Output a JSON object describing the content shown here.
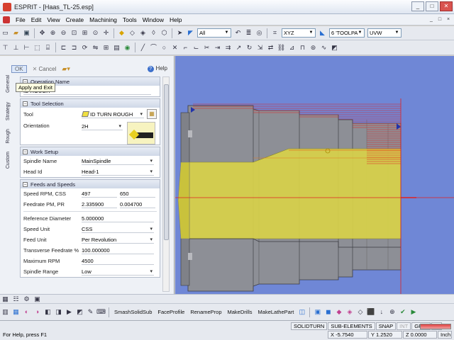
{
  "window": {
    "title": "ESPRIT - [Haas_TL-25.esp]",
    "buttons": [
      "_",
      "□",
      "✕"
    ]
  },
  "menu": {
    "items": [
      "File",
      "Edit",
      "View",
      "Create",
      "Machining",
      "Tools",
      "Window",
      "Help"
    ],
    "mdi_buttons": [
      "_",
      "□",
      "×"
    ]
  },
  "toolbar1": {
    "layer_combo": "All",
    "plane_combo": "XYZ",
    "toolpath_combo": "6 'TOOLPA",
    "work_combo": "UVW"
  },
  "dialog": {
    "ok_label": "OK",
    "cancel_label": "Cancel",
    "help_label": "Help",
    "tooltip": "Apply and Exit",
    "vertical_tabs": [
      "General",
      "Strategy",
      "Rough",
      "Custom"
    ],
    "operation_name_label": "Operation Name",
    "operation_name_value": "ID ROUGH",
    "tool_selection": {
      "header": "Tool Selection",
      "tool_label": "Tool",
      "tool_value": "ID TURN ROUGH",
      "orientation_label": "Orientation",
      "orientation_value": "2H"
    },
    "work_setup": {
      "header": "Work Setup",
      "spindle_name_label": "Spindle Name",
      "spindle_name_value": "MainSpindle",
      "head_id_label": "Head Id",
      "head_id_value": "Head-1"
    },
    "feeds": {
      "header": "Feeds and Speeds",
      "speed_rpm_label": "Speed RPM, CSS",
      "speed_rpm_value": "497",
      "css_value": "650",
      "feedrate_label": "Feedrate PM, PR",
      "feedrate_pm": "2.335900",
      "feedrate_pr": "0.004700",
      "ref_diameter_label": "Reference Diameter",
      "ref_diameter_value": "5.000000",
      "speed_unit_label": "Speed Unit",
      "speed_unit_value": "CSS",
      "feed_unit_label": "Feed Unit",
      "feed_unit_value": "Per Revolution",
      "transverse_label": "Transverse Feedrate %",
      "transverse_value": "100.000000",
      "max_rpm_label": "Maximum RPM",
      "max_rpm_value": "4500",
      "spindle_range_label": "Spindle Range",
      "spindle_range_value": "Low"
    }
  },
  "bottom_toolbar": {
    "buttons": [
      "SmashSolidSub",
      "FaceProfile",
      "RenameProp",
      "MakeDrills",
      "MakeLathePart"
    ]
  },
  "status": {
    "help_text": "For Help, press F1",
    "cells": [
      "SOLIDTURN",
      "SUB-ELEMENTS",
      "SNAP",
      "INT",
      "GRID",
      "HI"
    ],
    "x": "X -5.7540",
    "y": "Y 1.2520",
    "z": "Z 0.0000",
    "units": "Inch"
  },
  "colors": {
    "viewport_bg": "#6f87d6",
    "part_gray": "#8d8f96",
    "stock_yellow": "#d8d24a",
    "toolpath_red": "#e02020"
  }
}
